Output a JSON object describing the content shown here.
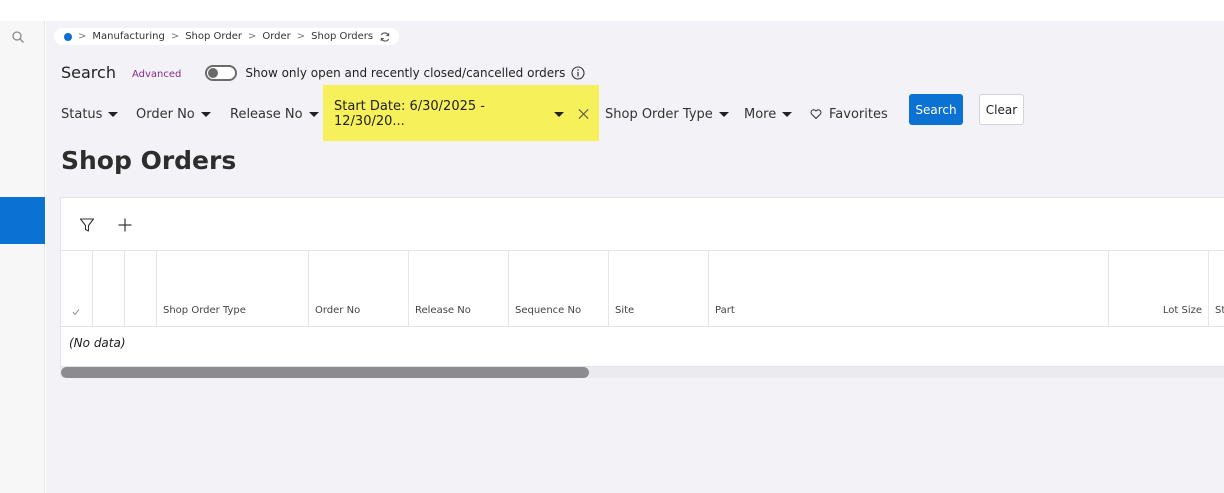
{
  "breadcrumb": {
    "items": [
      "Manufacturing",
      "Shop Order",
      "Order",
      "Shop Orders"
    ],
    "separator": ">"
  },
  "search": {
    "title": "Search",
    "advanced_label": "Advanced",
    "toggle_label": "Show only open and recently closed/cancelled orders",
    "toggle_on": false
  },
  "filters": {
    "status": "Status",
    "order_no": "Order No",
    "release_no": "Release No",
    "start_date": "Start Date: 6/30/2025 - 12/30/20...",
    "shop_order_type": "Shop Order Type",
    "more": "More",
    "favorites": "Favorites",
    "search_button": "Search",
    "clear_button": "Clear"
  },
  "page": {
    "title": "Shop Orders"
  },
  "table": {
    "columns": [
      "Shop Order Type",
      "Order No",
      "Release No",
      "Sequence No",
      "Site",
      "Part",
      "Lot Size",
      "St"
    ],
    "no_data": "(No data)"
  },
  "colors": {
    "accent": "#0b71d2",
    "highlight": "#f6f05a",
    "advanced_link": "#8a2c8f"
  }
}
